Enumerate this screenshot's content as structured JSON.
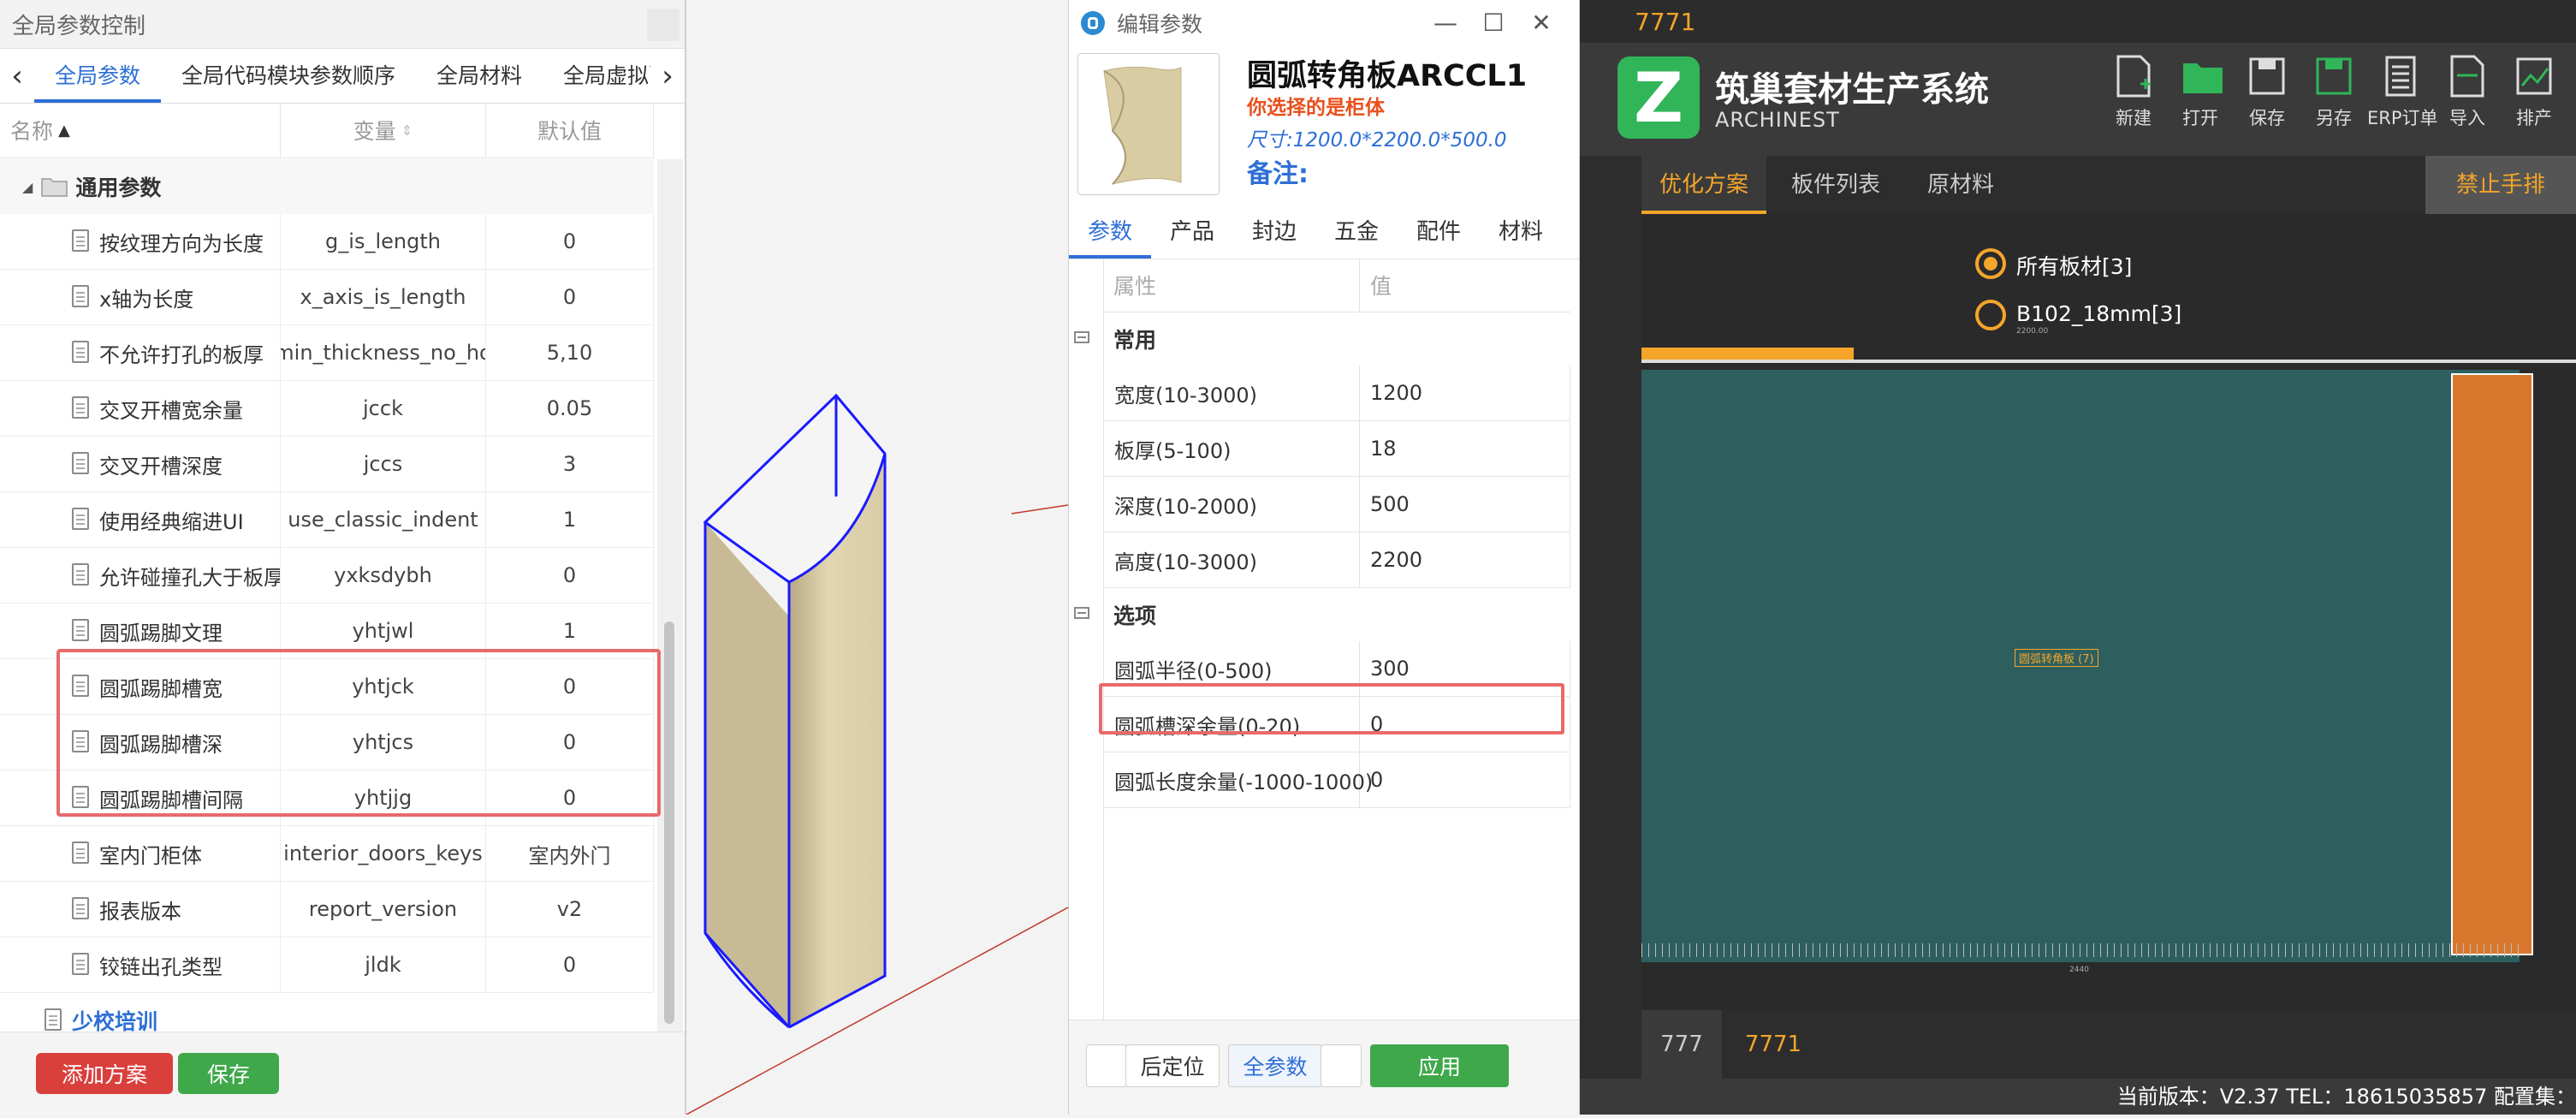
{
  "left_panel": {
    "title": "全局参数控制",
    "tabs": [
      "全局参数",
      "全局代码模块参数顺序",
      "全局材料",
      "全局虚拟配件"
    ],
    "columns": [
      "名称",
      "变量",
      "默认值"
    ],
    "group": "通用参数",
    "rows": [
      {
        "name": "按纹理方向为长度",
        "var": "g_is_length",
        "val": "0"
      },
      {
        "name": "x轴为长度",
        "var": "x_axis_is_length",
        "val": "0"
      },
      {
        "name": "不允许打孔的板厚",
        "var": "min_thickness_no_ho",
        "val": "5,10"
      },
      {
        "name": "交叉开槽宽余量",
        "var": "jcck",
        "val": "0.05"
      },
      {
        "name": "交叉开槽深度",
        "var": "jccs",
        "val": "3"
      },
      {
        "name": "使用经典缩进UI",
        "var": "use_classic_indent",
        "val": "1"
      },
      {
        "name": "允许碰撞孔大于板厚",
        "var": "yxksdybh",
        "val": "0"
      },
      {
        "name": "圆弧踢脚文理",
        "var": "yhtjwl",
        "val": "1"
      },
      {
        "name": "圆弧踢脚槽宽",
        "var": "yhtjck",
        "val": "0"
      },
      {
        "name": "圆弧踢脚槽深",
        "var": "yhtjcs",
        "val": "0"
      },
      {
        "name": "圆弧踢脚槽间隔",
        "var": "yhtjjg",
        "val": "0"
      },
      {
        "name": "室内门柜体",
        "var": "interior_doors_keys",
        "val": "室内外门"
      },
      {
        "name": "报表版本",
        "var": "report_version",
        "val": "v2"
      },
      {
        "name": "铰链出孔类型",
        "var": "jldk",
        "val": "0"
      }
    ],
    "subgroup": "少校培训",
    "add_button": "添加方案",
    "save_button": "保存"
  },
  "dialog": {
    "title": "编辑参数",
    "product_name": "圆弧转角板ARCCL1",
    "selection": "你选择的是柜体",
    "size": "尺寸:1200.0*2200.0*500.0",
    "note": "备注:",
    "tabs": [
      "参数",
      "产品",
      "封边",
      "五金",
      "配件",
      "材料"
    ],
    "columns": [
      "属性",
      "值"
    ],
    "sections": [
      {
        "title": "常用",
        "rows": [
          {
            "attr": "宽度(10-3000)",
            "val": "1200"
          },
          {
            "attr": "板厚(5-100)",
            "val": "18"
          },
          {
            "attr": "深度(10-2000)",
            "val": "500"
          },
          {
            "attr": "高度(10-3000)",
            "val": "2200"
          }
        ]
      },
      {
        "title": "选项",
        "rows": [
          {
            "attr": "圆弧半径(0-500)",
            "val": "300"
          },
          {
            "attr": "圆弧槽深余量(0-20)",
            "val": "0"
          },
          {
            "attr": "圆弧长度余量(-1000-1000)",
            "val": "0"
          }
        ]
      }
    ],
    "btn_position": "后定位",
    "btn_all": "全参数",
    "btn_apply": "应用"
  },
  "right_panel": {
    "window_title": "7771",
    "app_name": "筑巢套材生产系统",
    "app_sub": "ARCHINEST",
    "toolbar": [
      "新建",
      "打开",
      "保存",
      "另存",
      "ERP订单",
      "导入",
      "排产"
    ],
    "tabs": [
      "优化方案",
      "板件列表",
      "原材料"
    ],
    "stop_button": "禁止手排",
    "radio_all": "所有板材[3]",
    "radio_b102": "B102_18mm[3]",
    "part_label": "圆弧转角板 (7)",
    "dim_top": "2200.00",
    "dim_bottom": "2440",
    "bottom_tabs": [
      "777",
      "7771"
    ],
    "status": "当前版本：V2.37 TEL：18615035857   配置集："
  },
  "colors": {
    "accent_blue": "#2e6fd6",
    "highlight_red": "#e86a6a",
    "app_green": "#31b559",
    "app_orange": "#f4a52a",
    "board_teal": "#2e5f5f"
  }
}
